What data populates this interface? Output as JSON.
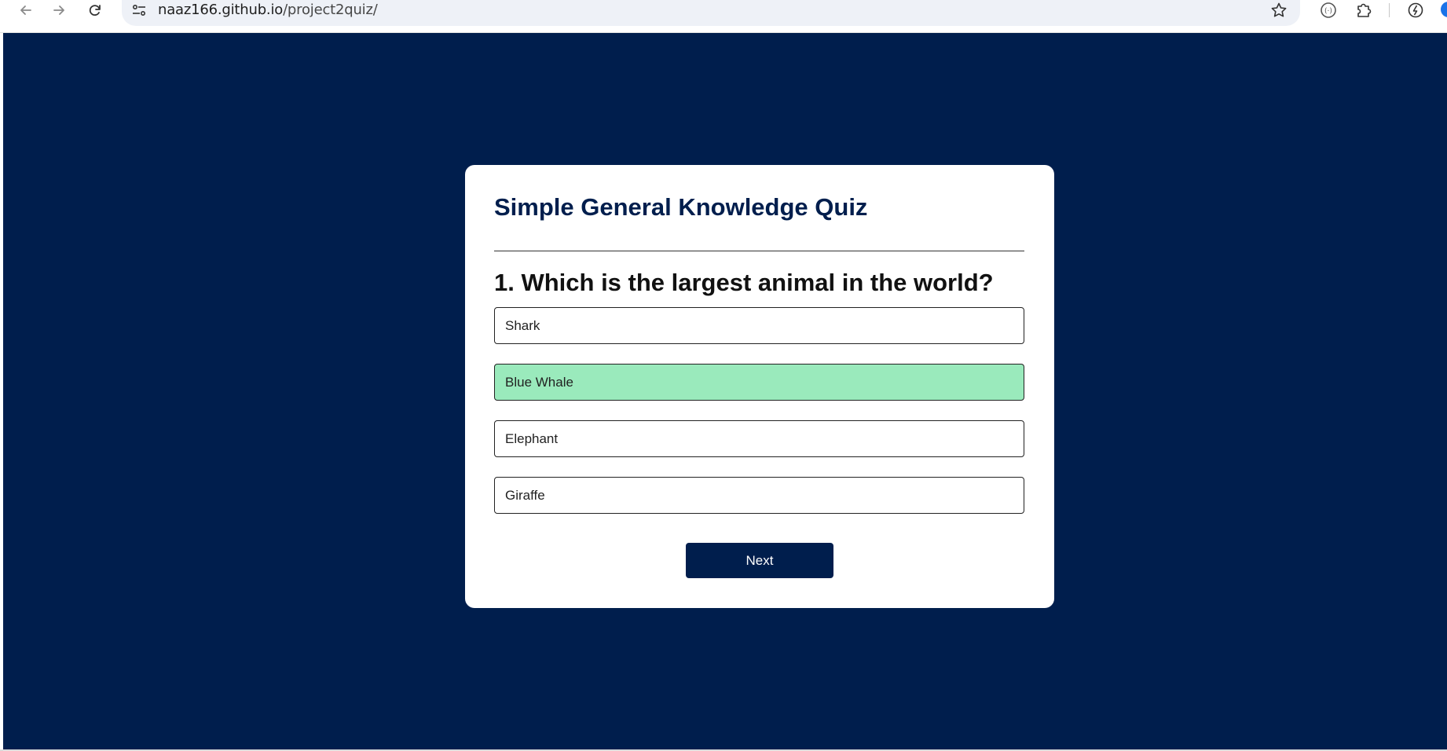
{
  "browser": {
    "url_host": "naaz166.github.io",
    "url_path": "/project2quiz/",
    "icons": [
      "back-arrow-icon",
      "forward-arrow-icon",
      "reload-icon",
      "site-info-icon",
      "bookmark-star-icon",
      "extension-icon",
      "puzzle-icon",
      "performance-icon",
      "profile-avatar"
    ]
  },
  "quiz": {
    "title": "Simple General Knowledge Quiz",
    "question": "1. Which is the largest animal in the world?",
    "answers": [
      {
        "label": "Shark",
        "state": "default"
      },
      {
        "label": "Blue Whale",
        "state": "correct"
      },
      {
        "label": "Elephant",
        "state": "default"
      },
      {
        "label": "Giraffe",
        "state": "default"
      }
    ],
    "next_label": "Next"
  },
  "colors": {
    "page_background": "#001e4d",
    "card_background": "#ffffff",
    "correct_answer": "#9aeabc",
    "next_button": "#001e4d"
  }
}
